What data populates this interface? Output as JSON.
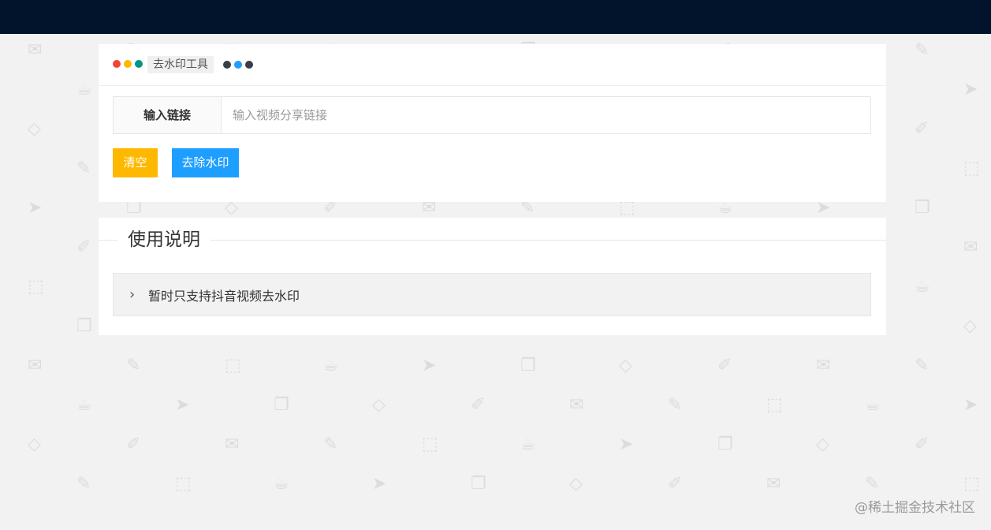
{
  "tool": {
    "title": "去水印工具",
    "input_label": "输入链接",
    "input_placeholder": "输入视频分享链接",
    "input_value": "",
    "clear_label": "清空",
    "remove_label": "去除水印"
  },
  "dots": {
    "left": [
      "#f44336",
      "#ffb800",
      "#009688"
    ],
    "right": [
      "#393d49",
      "#1e9fff",
      "#393d49"
    ]
  },
  "instructions": {
    "legend": "使用说明",
    "item": "暂时只支持抖音视频去水印"
  },
  "watermark": "@稀土掘金技术社区",
  "colors": {
    "topbar": "#02142b",
    "background": "#f2f2f2",
    "warm": "#ffb800",
    "normal": "#1e9fff"
  }
}
